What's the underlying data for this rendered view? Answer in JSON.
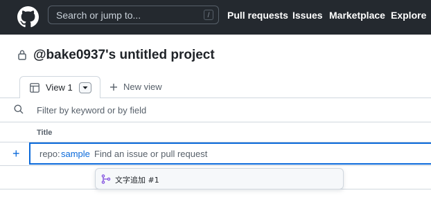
{
  "header": {
    "search_placeholder": "Search or jump to...",
    "search_shortcut": "/",
    "nav": [
      "Pull requests",
      "Issues",
      "Marketplace",
      "Explore"
    ]
  },
  "project": {
    "title": "@bake0937's untitled project",
    "lock_icon": "lock-icon"
  },
  "views": {
    "active_tab": "View 1",
    "new_view": "New view"
  },
  "filter": {
    "placeholder": "Filter by keyword or by field"
  },
  "table": {
    "columns": [
      "Title"
    ]
  },
  "add_item": {
    "query_key": "repo:",
    "query_value": "sample",
    "placeholder": "Find an issue or pull request"
  },
  "suggestions": [
    {
      "icon": "pull-request-icon",
      "label": "文字追加 #1"
    }
  ],
  "colors": {
    "header_bg": "#24292f",
    "accent": "#0969da",
    "pr_open": "#8250df"
  }
}
